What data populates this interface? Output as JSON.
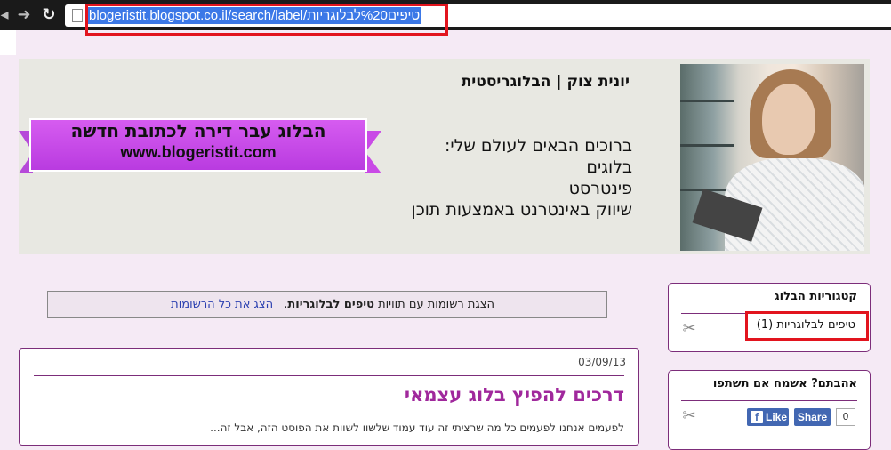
{
  "browser": {
    "back_icon": "arrow-left-icon",
    "forward_icon": "arrow-right-icon",
    "reload_icon": "reload-icon",
    "url": "blogeristit.blogspot.co.il/search/label/טיפים%20לבלוגריות"
  },
  "header": {
    "brand_title": "יונית צוק | הבלוגריסטית",
    "welcome_lines": [
      "ברוכים הבאים לעולם שלי:",
      "בלוגים",
      "פינטרסט",
      "שיווק באינטרנט באמצעות תוכן"
    ],
    "ribbon_line1": "הבלוג עבר דירה לכתובת חדשה",
    "ribbon_line2": "www.blogeristit.com"
  },
  "status": {
    "prefix": "הצגת רשומות עם תוויות",
    "label": "טיפים לבלוגריות",
    "suffix": ".",
    "show_all": "הצג את כל הרשומות"
  },
  "post": {
    "date": "03/09/13",
    "title": "דרכים להפיץ בלוג עצמאי",
    "excerpt": "לפעמים אנחנו לפעמים כל מה שרציתי זה עוד עמוד שלשוו לשוות את הפוסט הזה, אבל זה..."
  },
  "widgets": {
    "categories": {
      "title": "קטגוריות הבלוג",
      "item": "טיפים לבלוגריות (1)"
    },
    "share": {
      "title": "אהבתם? אשמח אם תשתפו",
      "like_label": "Like",
      "share_label": "Share",
      "count": "0"
    }
  },
  "colors": {
    "page_bg": "#f5eaf5",
    "accent": "#7c2d7a",
    "title": "#a0289c",
    "highlight": "#e2141e",
    "facebook": "#4267b2"
  }
}
